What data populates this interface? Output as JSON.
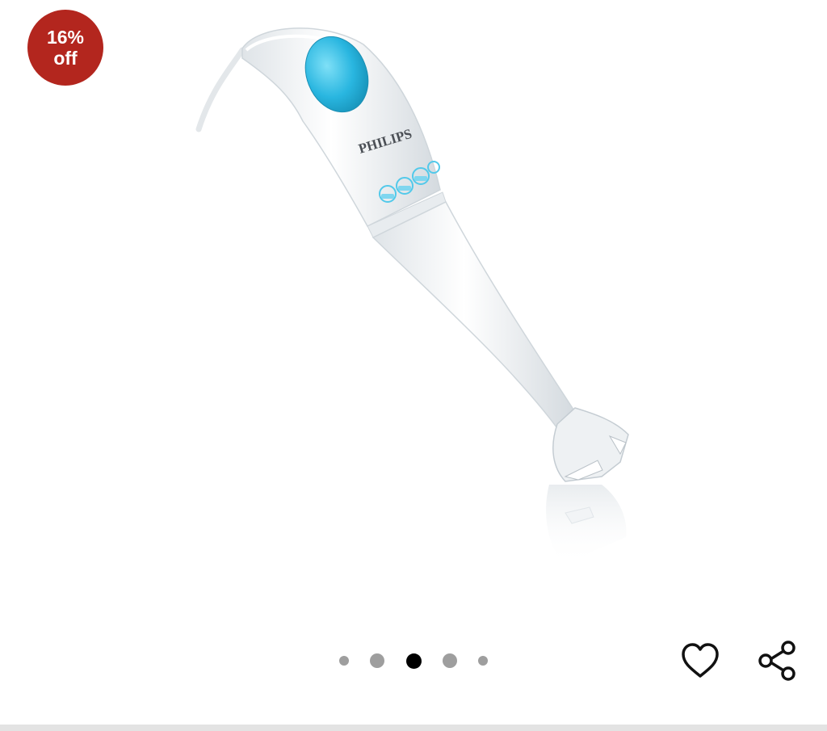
{
  "badge": {
    "line1": "16%",
    "line2": "off"
  },
  "product": {
    "brand_text": "PHILIPS",
    "image_icon": "hand-blender-image"
  },
  "carousel": {
    "count": 5,
    "active_index": 2
  },
  "actions": {
    "wishlist_icon": "heart-icon",
    "share_icon": "share-icon"
  },
  "colors": {
    "badge": "#b3261e",
    "accent": "#29b6e0",
    "dot_active": "#000000",
    "dot_inactive": "#9e9e9e"
  }
}
